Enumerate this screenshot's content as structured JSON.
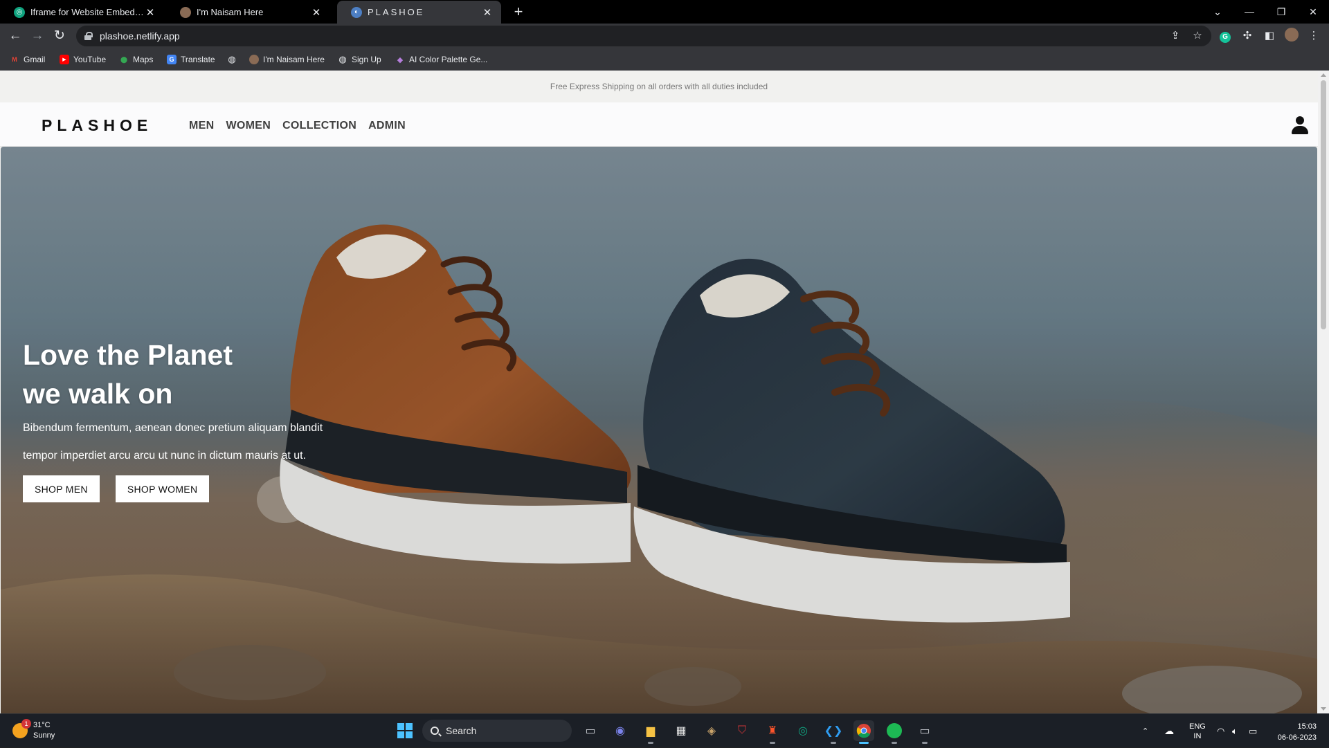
{
  "browser": {
    "tabs": [
      {
        "title": "Iframe for Website Embedding.",
        "close": "✕",
        "active": false,
        "fav_color": "#10a37f"
      },
      {
        "title": "I'm Naisam Here",
        "close": "✕",
        "active": false,
        "fav_color": "#8a6b55"
      },
      {
        "title": "PLASHOE",
        "close": "✕",
        "active": true,
        "fav_color": "#4d7fc4"
      }
    ],
    "new_tab": "+",
    "url": "plashoe.netlify.app",
    "bookmarks": [
      {
        "label": "Gmail",
        "icon": "gmail-icon",
        "glyph": "M",
        "color": "#ea4335"
      },
      {
        "label": "YouTube",
        "icon": "youtube-icon",
        "glyph": "▶",
        "color": "#ff0000"
      },
      {
        "label": "Maps",
        "icon": "maps-icon",
        "glyph": "●",
        "color": "#34a853"
      },
      {
        "label": "Translate",
        "icon": "translate-icon",
        "glyph": "G",
        "color": "#4285f4"
      },
      {
        "label": "",
        "icon": "globe-icon",
        "glyph": "◍",
        "color": "#5f6368"
      },
      {
        "label": "I'm Naisam Here",
        "icon": "profile-favicon",
        "glyph": "",
        "color": "#8a6b55"
      },
      {
        "label": "Sign Up",
        "icon": "globe-icon",
        "glyph": "◍",
        "color": "#5f6368"
      },
      {
        "label": "AI Color Palette Ge...",
        "icon": "droplet-icon",
        "glyph": "◆",
        "color": "#b57edc"
      }
    ]
  },
  "site": {
    "announcement": "Free Express Shipping on all orders with all duties included",
    "logo": "PLASHOE",
    "nav": [
      "MEN",
      "WOMEN",
      "COLLECTION",
      "ADMIN"
    ],
    "hero": {
      "title_line1": "Love the Planet",
      "title_line2": "we walk on",
      "text_line1": "Bibendum fermentum, aenean donec pretium aliquam blandit",
      "text_line2": "tempor imperdiet arcu arcu ut nunc in dictum mauris at ut.",
      "button_men": "SHOP MEN",
      "button_women": "SHOP WOMEN"
    }
  },
  "taskbar": {
    "weather_temp": "31°C",
    "weather_desc": "Sunny",
    "weather_badge": "1",
    "search": "Search",
    "lang": "ENG",
    "region": "IN",
    "time": "15:03",
    "date": "06-06-2023"
  }
}
